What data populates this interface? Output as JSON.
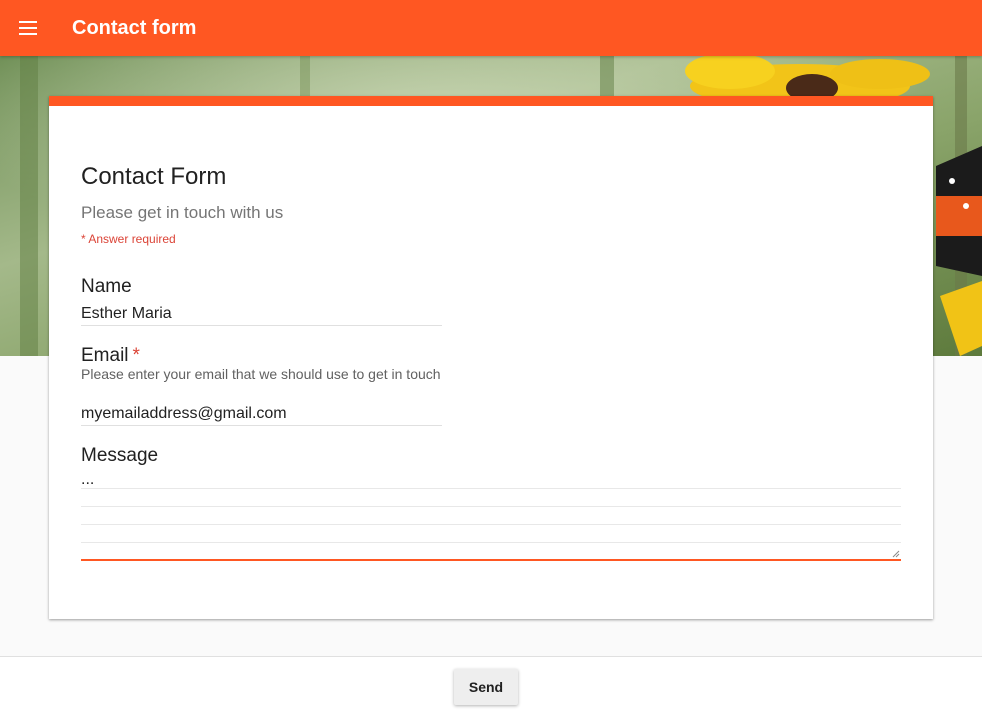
{
  "app": {
    "title": "Contact form",
    "accent": "#ff5722"
  },
  "form": {
    "title": "Contact Form",
    "description": "Please get in touch with us",
    "required_note": "* Answer required",
    "fields": {
      "name": {
        "label": "Name",
        "value": "Esther Maria"
      },
      "email": {
        "label": "Email",
        "required_marker": "*",
        "help": "Please enter your email that we should use to get in touch",
        "value": "myemailaddress@gmail.com"
      },
      "message": {
        "label": "Message",
        "value": "..."
      }
    }
  },
  "footer": {
    "send_label": "Send"
  },
  "icons": {
    "menu": "menu-icon",
    "resize": "resize-handle-icon"
  },
  "colors": {
    "accent": "#ff5722",
    "required": "#db4437"
  }
}
